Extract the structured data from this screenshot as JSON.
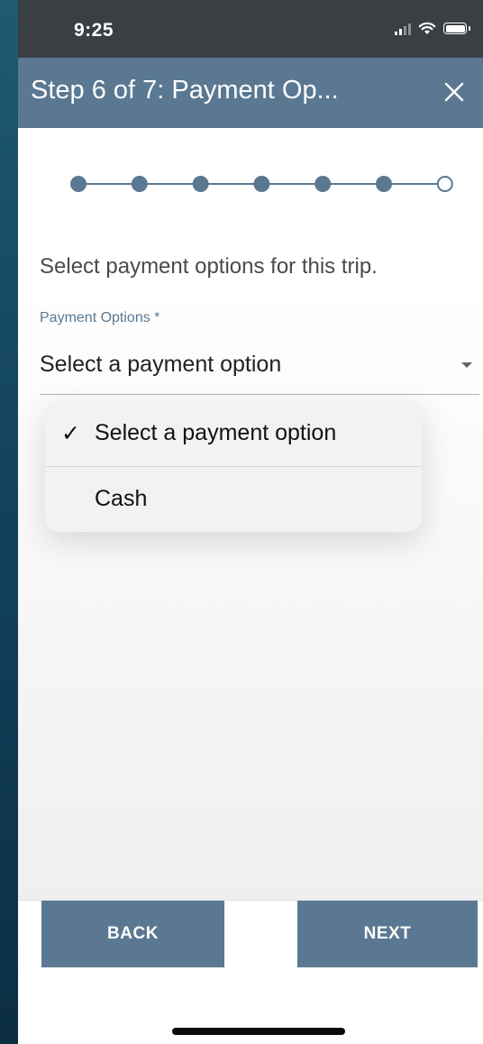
{
  "status_bar": {
    "time": "9:25"
  },
  "header": {
    "title": "Step 6 of 7: Payment Op..."
  },
  "stepper": {
    "total_steps": 7,
    "current_step": 6
  },
  "form": {
    "instruction": "Select payment options for this trip.",
    "payment_label": "Payment Options *",
    "payment_value": "Select a payment option"
  },
  "dropdown": {
    "items": [
      {
        "check": "✓",
        "label": "Select a payment option",
        "selected": true
      },
      {
        "label": "Cash",
        "selected": false
      }
    ]
  },
  "footer": {
    "back_label": "BACK",
    "next_label": "NEXT"
  },
  "colors": {
    "accent": "#5a7891",
    "status_bar": "#3a3f44",
    "background": "#0f3a52"
  },
  "icons": [
    "signal-icon",
    "wifi-icon",
    "battery-icon",
    "close-icon",
    "chevron-down-icon",
    "checkmark-icon"
  ]
}
